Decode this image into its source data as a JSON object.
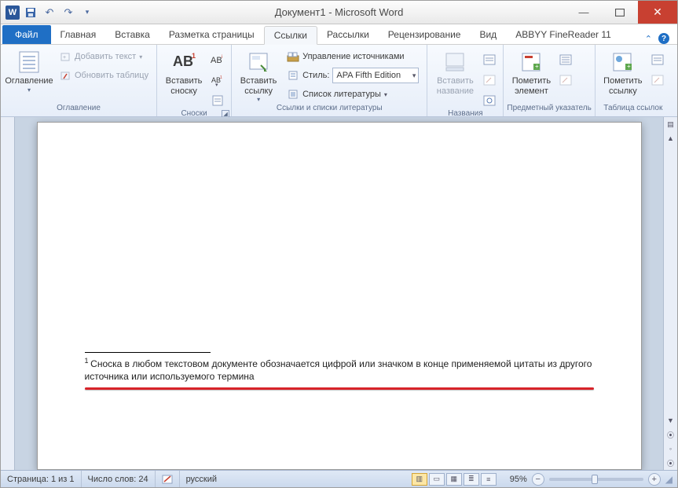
{
  "title": "Документ1 - Microsoft Word",
  "app_icon_letter": "W",
  "tabs": {
    "file": "Файл",
    "items": [
      "Главная",
      "Вставка",
      "Разметка страницы",
      "Ссылки",
      "Рассылки",
      "Рецензирование",
      "Вид",
      "ABBYY FineReader 11"
    ],
    "active_index": 3
  },
  "ribbon": {
    "groups": {
      "toc": {
        "label": "Оглавление",
        "big": "Оглавление",
        "add_text": "Добавить текст",
        "update_table": "Обновить таблицу"
      },
      "footnotes": {
        "label": "Сноски",
        "big": "Вставить сноску",
        "ab_mark": "AB"
      },
      "citations": {
        "label": "Ссылки и списки литературы",
        "big": "Вставить ссылку",
        "manage": "Управление источниками",
        "style_lbl": "Стиль:",
        "style_val": "APA Fifth Edition",
        "biblio": "Список литературы"
      },
      "captions": {
        "label": "Названия",
        "big": "Вставить название"
      },
      "index": {
        "label": "Предметный указатель",
        "big": "Пометить элемент"
      },
      "toa": {
        "label": "Таблица ссылок",
        "big": "Пометить ссылку"
      }
    }
  },
  "document": {
    "footnote_marker": "1",
    "footnote_text": "Сноска в любом текстовом документе обозначается цифрой или значком в конце применяемой цитаты из другого источника или используемого термина"
  },
  "status": {
    "page": "Страница: 1 из 1",
    "words": "Число слов: 24",
    "lang": "русский",
    "zoom": "95%",
    "zoom_value": 95
  }
}
